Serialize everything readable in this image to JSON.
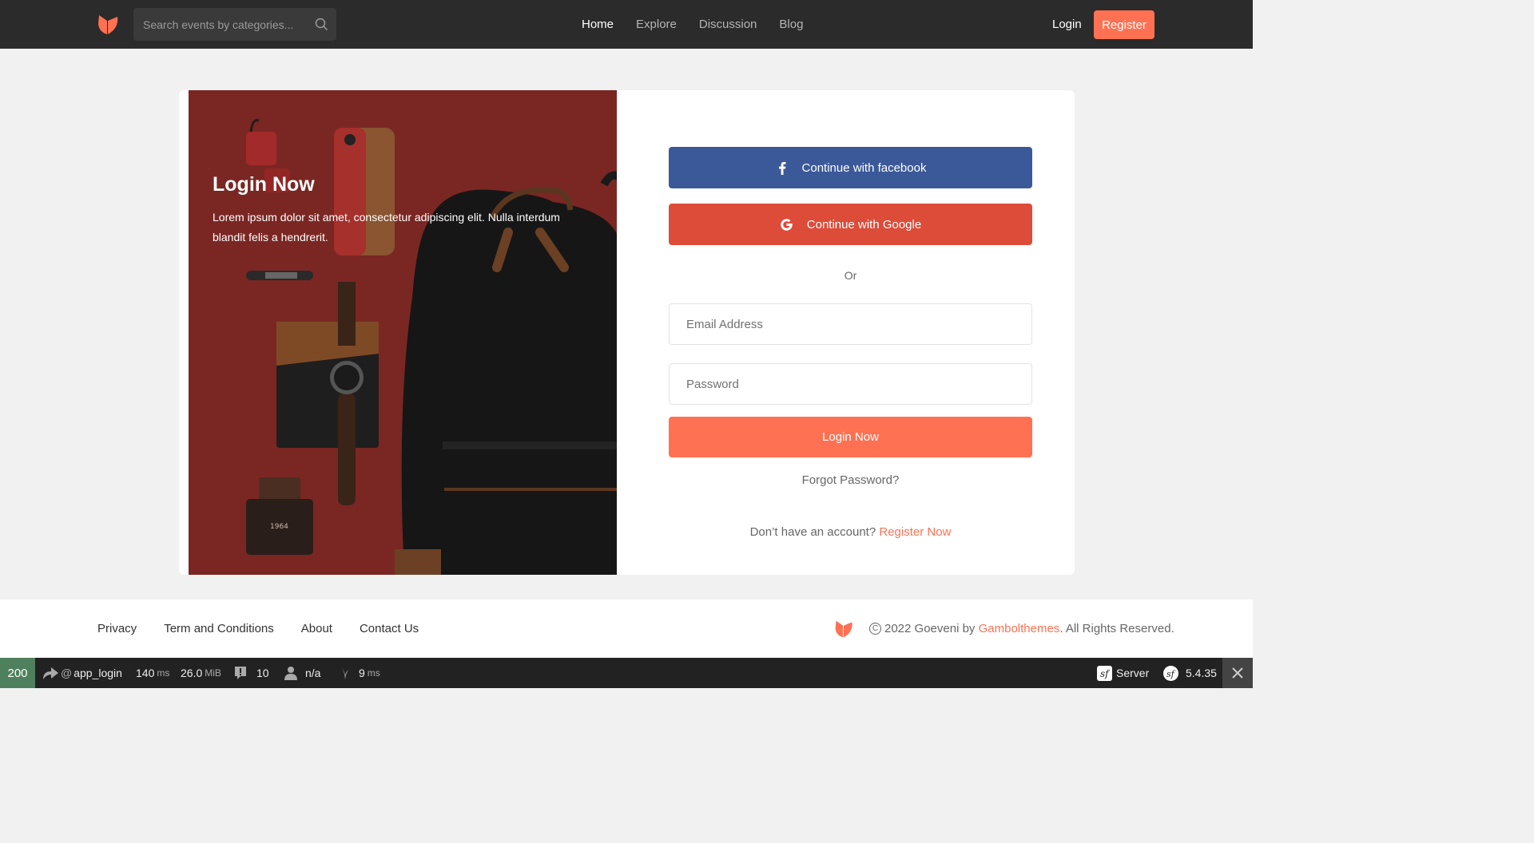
{
  "header": {
    "search_placeholder": "Search events by categories...",
    "nav": [
      "Home",
      "Explore",
      "Discussion",
      "Blog"
    ],
    "active_nav": "Home",
    "login_label": "Login",
    "register_label": "Register"
  },
  "hero": {
    "title": "Login Now",
    "text": "Lorem ipsum dolor sit amet, consectetur adipiscing elit. Nulla interdum blandit felis a hendrerit."
  },
  "form": {
    "facebook_label": "Continue with facebook",
    "google_label": "Continue with Google",
    "or_label": "Or",
    "email_placeholder": "Email Address",
    "password_placeholder": "Password",
    "login_button": "Login Now",
    "forgot_label": "Forgot Password?",
    "no_account_text": "Don’t have an account?",
    "register_now_label": "Register Now"
  },
  "footer": {
    "links": [
      "Privacy",
      "Term and Conditions",
      "About",
      "Contact Us"
    ],
    "copyright_prefix": "2022 Goeveni by",
    "brand_link": "Gambolthemes",
    "copyright_suffix": ". All Rights Reserved."
  },
  "debug_toolbar": {
    "status": "200",
    "route_prefix": "@",
    "route": "app_login",
    "time_value": "140",
    "time_unit": "ms",
    "memory_value": "26.0",
    "memory_unit": "MiB",
    "logs_count": "10",
    "user": "n/a",
    "render_value": "9",
    "render_unit": "ms",
    "server_label": "Server",
    "version": "5.4.35"
  },
  "colors": {
    "accent": "#ff7152",
    "header_bg": "#2b2b2b",
    "facebook": "#3b5998",
    "google": "#dd4b39",
    "hero_bg": "#7a2723",
    "status_ok": "#4f805d"
  },
  "icons": [
    "logo-icon",
    "search-icon",
    "facebook-icon",
    "google-icon",
    "copyright-icon",
    "route-icon",
    "logs-icon",
    "user-icon",
    "render-icon",
    "symfony-icon",
    "close-icon"
  ]
}
